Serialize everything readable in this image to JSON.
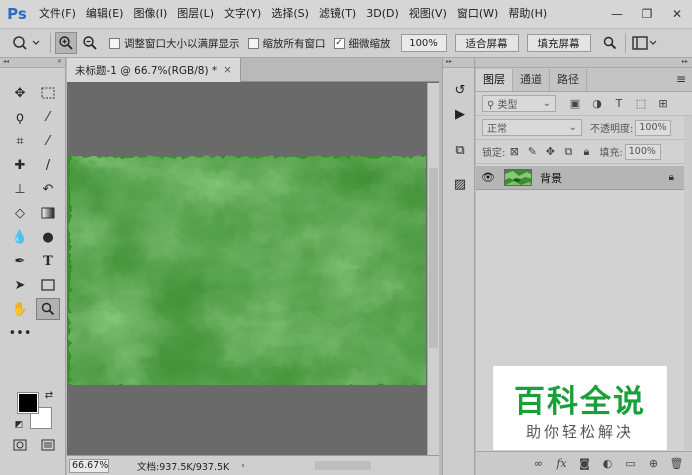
{
  "app": {
    "logo": "Ps",
    "menu": [
      "文件(F)",
      "编辑(E)",
      "图像(I)",
      "图层(L)",
      "文字(Y)",
      "选择(S)",
      "滤镜(T)",
      "3D(D)",
      "视图(V)",
      "窗口(W)",
      "帮助(H)"
    ],
    "window_controls": {
      "minimize": "—",
      "restore": "❐",
      "close": "✕"
    }
  },
  "options_bar": {
    "resize_window_label": "调整窗口大小以满屏显示",
    "resize_window_checked": false,
    "zoom_all_label": "缩放所有窗口",
    "zoom_all_checked": false,
    "scrubby_zoom_label": "细微缩放",
    "scrubby_zoom_checked": true,
    "zoom_value": "100%",
    "fit_screen_label": "适合屏幕",
    "fill_screen_label": "填充屏幕"
  },
  "document": {
    "tab_title": "未标题-1 @ 66.7%(RGB/8) *",
    "tab_close": "×",
    "status_zoom": "66.67%",
    "status_info": "文档:937.5K/937.5K",
    "status_arrow": "›",
    "texture_colors": {
      "dark": "#1e5a16",
      "mid": "#3e8c32",
      "light": "#8ed07c"
    }
  },
  "layers_panel": {
    "tabs": [
      "图层",
      "通道",
      "路径"
    ],
    "active_tab": "图层",
    "kind_filter": "类型",
    "blend_mode": "正常",
    "opacity_label": "不透明度:",
    "opacity_value": "100%",
    "lock_label": "锁定:",
    "fill_label": "填充:",
    "fill_value": "100%",
    "layer_name": "背景"
  },
  "watermark": {
    "title": "百科全说",
    "subtitle": "助你轻松解决"
  }
}
